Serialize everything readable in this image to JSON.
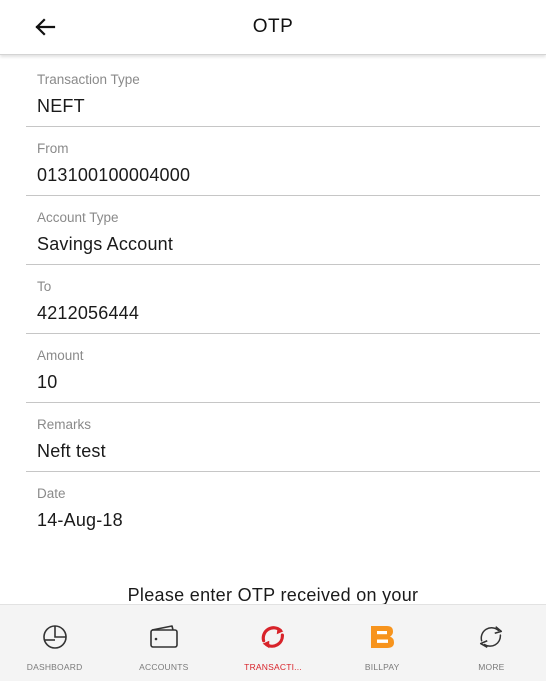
{
  "header": {
    "back_icon": "arrow-left-icon",
    "title": "OTP"
  },
  "fields": [
    {
      "label": "Transaction Type",
      "value": "NEFT"
    },
    {
      "label": "From",
      "value": "013100100004000"
    },
    {
      "label": "Account Type",
      "value": "Savings Account"
    },
    {
      "label": "To",
      "value": "4212056444"
    },
    {
      "label": "Amount",
      "value": "10"
    },
    {
      "label": "Remarks",
      "value": "Neft test"
    },
    {
      "label": "Date",
      "value": "14-Aug-18"
    }
  ],
  "otp_message": "Please enter OTP received on your",
  "bottom_nav": {
    "items": [
      {
        "label": "DASHBOARD",
        "icon": "pie-chart-icon",
        "active": false
      },
      {
        "label": "ACCOUNTS",
        "icon": "wallet-icon",
        "active": false
      },
      {
        "label": "TRANSACTI...",
        "icon": "transfer-arrows-icon",
        "active": true
      },
      {
        "label": "BILLPAY",
        "icon": "billpay-logo-icon",
        "active": false
      },
      {
        "label": "MORE",
        "icon": "refresh-arrows-icon",
        "active": false
      }
    ]
  },
  "colors": {
    "active": "#d8232a",
    "billpay_orange": "#f7941d",
    "icon_dark": "#333333",
    "divider": "#c6c6c6",
    "label_gray": "#8a8a8a"
  }
}
